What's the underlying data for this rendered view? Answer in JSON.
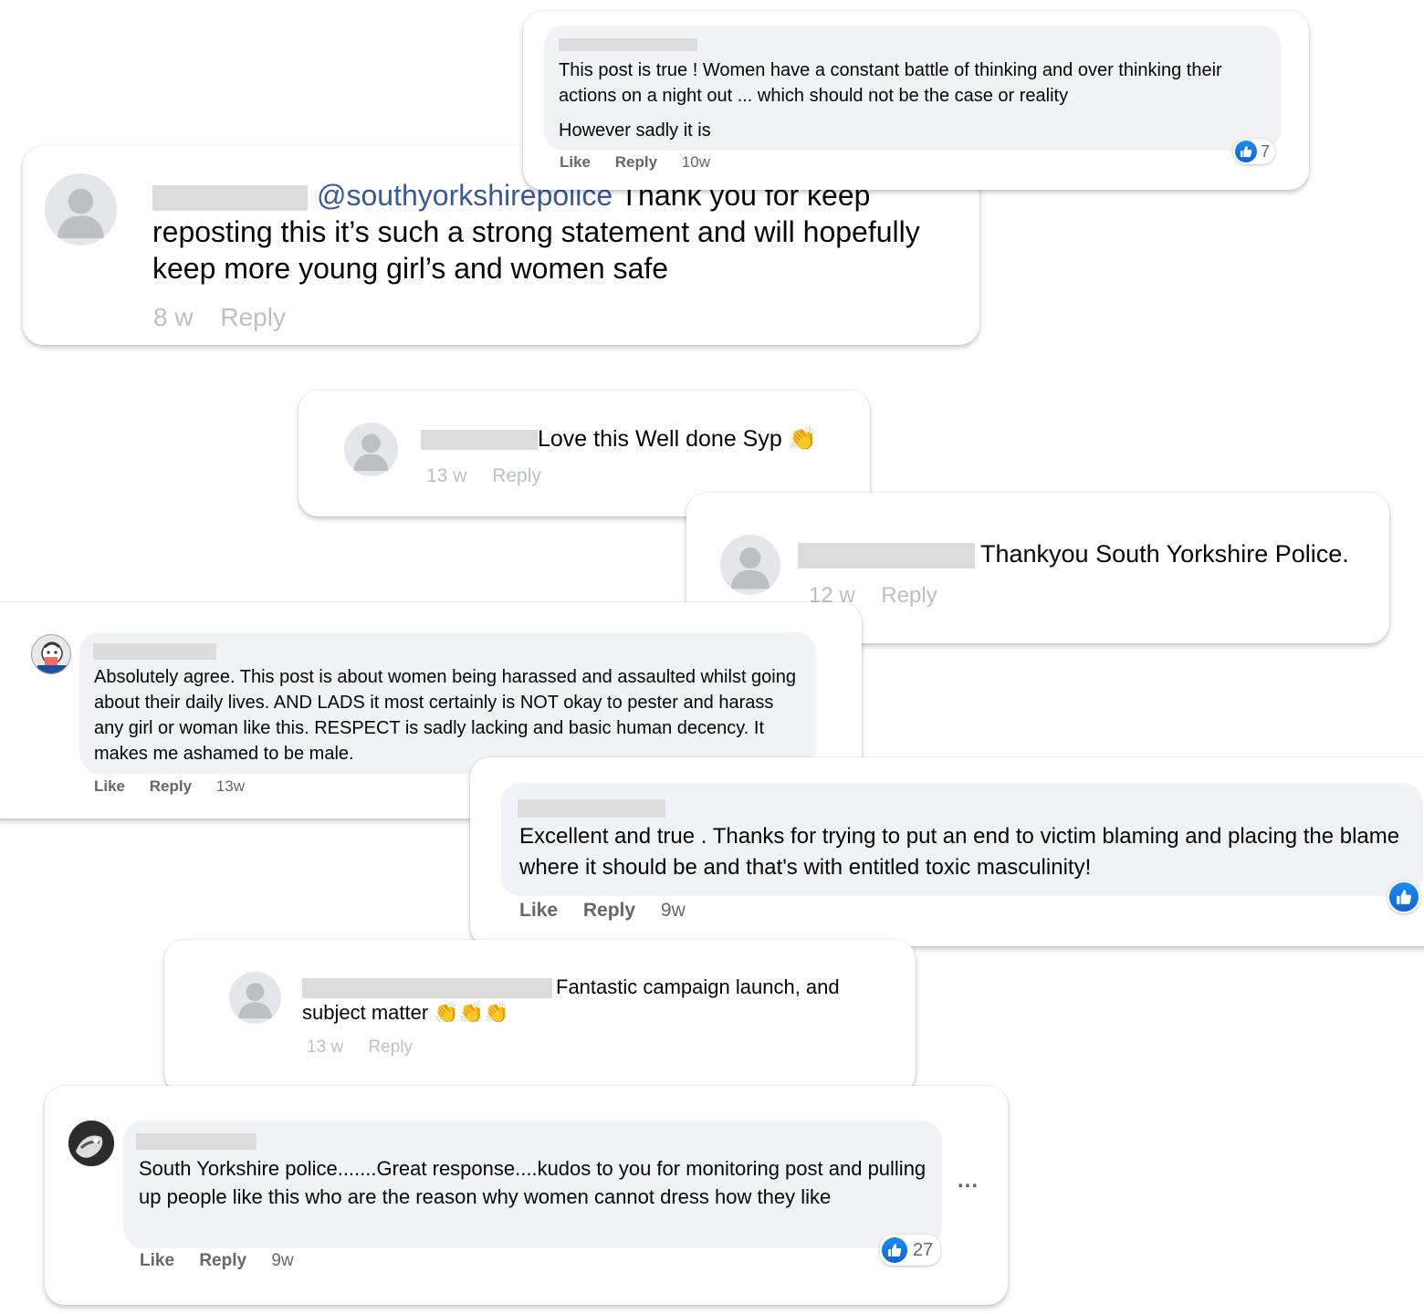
{
  "comments": [
    {
      "id": "c1",
      "text": "This post is true ! Women have a constant battle of thinking and over thinking their actions on a night out ... which should not be the case or reality",
      "text2": "However sadly it is",
      "actions": {
        "like": "Like",
        "reply": "Reply",
        "time": "10w"
      },
      "reactions": "7"
    },
    {
      "id": "c2",
      "mention": "@southyorkshirepolice",
      "text": "Thank you for keep reposting this it’s such a strong statement and will hopefully keep more young girl’s and women safe",
      "actions": {
        "time": "8 w",
        "reply": "Reply"
      }
    },
    {
      "id": "c3",
      "text": "Love this Well done Syp 👏",
      "actions": {
        "time": "13 w",
        "reply": "Reply"
      }
    },
    {
      "id": "c4",
      "text": "Thankyou South Yorkshire Police.",
      "actions": {
        "time": "12 w",
        "reply": "Reply"
      }
    },
    {
      "id": "c5",
      "text": "Absolutely agree. This post is about women being harassed and assaulted whilst going about their daily lives. AND LADS it most certainly is NOT okay to pester and harass any girl or woman like this. RESPECT is sadly lacking and basic human decency. It makes me ashamed to be male.",
      "actions": {
        "like": "Like",
        "reply": "Reply",
        "time": "13w"
      }
    },
    {
      "id": "c6",
      "text": "Excellent and true . Thanks for trying to put an end to victim blaming and placing the blame where it should be and that's with entitled toxic masculinity!",
      "actions": {
        "like": "Like",
        "reply": "Reply",
        "time": "9w"
      }
    },
    {
      "id": "c7",
      "text": "Fantastic campaign launch, and subject matter 👏👏👏",
      "actions": {
        "time": "13 w",
        "reply": "Reply"
      }
    },
    {
      "id": "c8",
      "text": "South Yorkshire police.......Great response....kudos to you for monitoring post and pulling up people like this who are the reason why women cannot dress how they like",
      "actions": {
        "like": "Like",
        "reply": "Reply",
        "time": "9w"
      },
      "reactions": "27",
      "more": "..."
    }
  ],
  "icons": {
    "like_badge": "thumbs-up-icon",
    "avatar": "person-placeholder-icon",
    "more": "ellipsis-icon"
  },
  "colors": {
    "like_blue": "#1877f2",
    "mention_blue": "#385898",
    "bubble_gray": "#f0f2f5",
    "meta_gray": "#65676b",
    "redaction": "#dcdcdc"
  }
}
